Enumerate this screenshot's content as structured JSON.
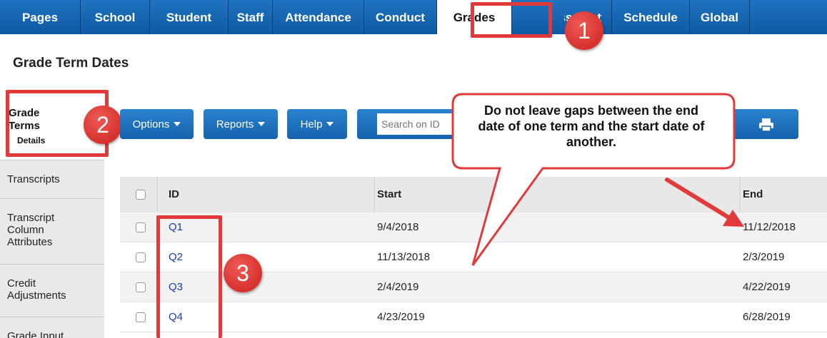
{
  "nav": {
    "tabs": [
      "Pages",
      "School",
      "Student",
      "Staff",
      "Attendance",
      "Conduct",
      "Grades",
      "Assessment",
      "Schedule",
      "Global"
    ],
    "active": "Grades",
    "active_color": "#ffffff",
    "brand_color": "#1666b4"
  },
  "page": {
    "title": "Grade Term Dates"
  },
  "sidebar": {
    "active_title_line1": "Grade",
    "active_title_line2": "Terms",
    "active_sub": "Details",
    "items": [
      {
        "label": "Transcripts"
      },
      {
        "label": "Transcript Column Attributes"
      },
      {
        "label": "Credit Adjustments"
      },
      {
        "label": "Grade Input"
      }
    ]
  },
  "toolbar": {
    "options_label": "Options",
    "reports_label": "Reports",
    "help_label": "Help",
    "search_placeholder": "Search on ID",
    "print_icon": "printer-icon"
  },
  "table": {
    "columns": [
      "ID",
      "Start",
      "End"
    ],
    "rows": [
      {
        "id": "Q1",
        "start": "9/4/2018",
        "end": "11/12/2018"
      },
      {
        "id": "Q2",
        "start": "11/13/2018",
        "end": "2/3/2019"
      },
      {
        "id": "Q3",
        "start": "2/4/2019",
        "end": "4/22/2019"
      },
      {
        "id": "Q4",
        "start": "4/23/2019",
        "end": "6/28/2019"
      }
    ]
  },
  "annotations": {
    "badge1": "1",
    "badge2": "2",
    "badge3": "3",
    "callout_text": "Do not leave gaps between the end date of one term and the start date of another.",
    "highlight_color": "#e03a3a"
  }
}
